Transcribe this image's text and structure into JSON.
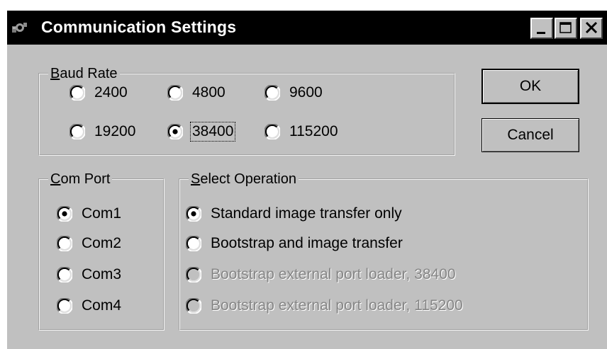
{
  "window": {
    "title": "Communication Settings",
    "controls": [
      "minimize-icon",
      "maximize-icon",
      "close-icon"
    ]
  },
  "baud_rate": {
    "label_accel": "B",
    "label_rest": "aud Rate",
    "selected": "38400",
    "options": [
      {
        "label": "2400",
        "checked": false
      },
      {
        "label": "4800",
        "checked": false
      },
      {
        "label": "9600",
        "checked": false
      },
      {
        "label": "19200",
        "checked": false
      },
      {
        "label": "38400",
        "checked": true
      },
      {
        "label": "115200",
        "checked": false
      }
    ]
  },
  "com_port": {
    "label_accel": "C",
    "label_rest": "om Port",
    "selected": "Com1",
    "options": [
      {
        "label": "Com1",
        "checked": true
      },
      {
        "label": "Com2",
        "checked": false
      },
      {
        "label": "Com3",
        "checked": false
      },
      {
        "label": "Com4",
        "checked": false
      }
    ]
  },
  "select_operation": {
    "label_accel": "S",
    "label_rest": "elect Operation",
    "selected": "Standard image transfer only",
    "options": [
      {
        "label": "Standard image transfer only",
        "checked": true,
        "enabled": true
      },
      {
        "label": "Bootstrap and image transfer",
        "checked": false,
        "enabled": true
      },
      {
        "label": "Bootstrap external port loader, 38400",
        "checked": false,
        "enabled": false
      },
      {
        "label": "Bootstrap external port loader, 115200",
        "checked": false,
        "enabled": false
      }
    ]
  },
  "buttons": {
    "ok": "OK",
    "cancel": "Cancel"
  }
}
